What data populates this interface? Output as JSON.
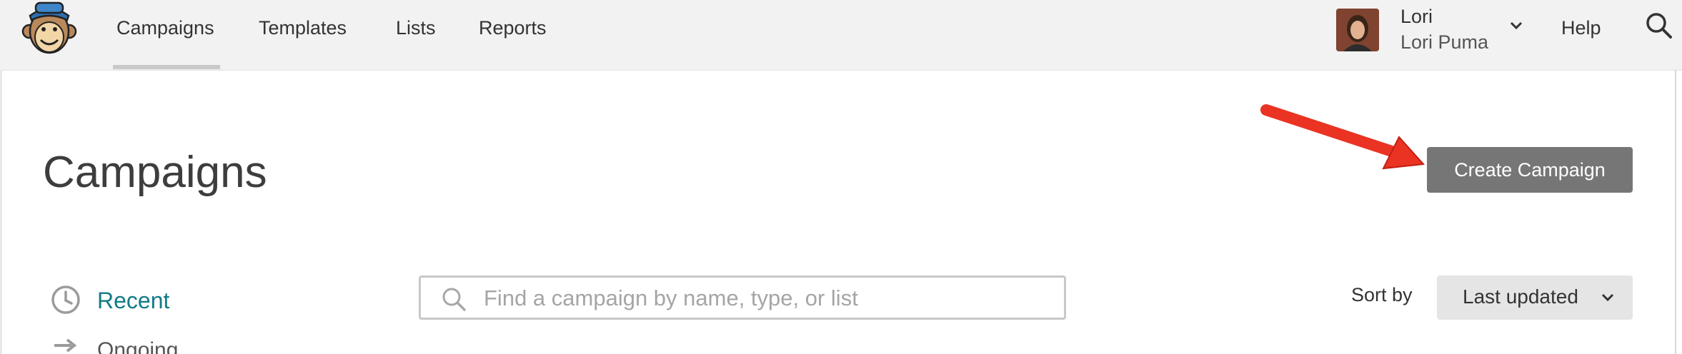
{
  "nav": {
    "items": [
      {
        "label": "Campaigns",
        "active": true
      },
      {
        "label": "Templates",
        "active": false
      },
      {
        "label": "Lists",
        "active": false
      },
      {
        "label": "Reports",
        "active": false
      }
    ],
    "user": {
      "first_name": "Lori",
      "full_name": "Lori Puma"
    },
    "help_label": "Help",
    "icons": {
      "logo": "freddie-logo-icon",
      "chevron": "chevron-down-icon",
      "search": "search-icon"
    }
  },
  "page": {
    "title": "Campaigns",
    "create_button_label": "Create Campaign",
    "annotation_color": "#ea3323"
  },
  "filters": [
    {
      "label": "Recent",
      "icon": "clock-icon",
      "active": true
    },
    {
      "label": "Ongoing",
      "icon": "arrows-icon",
      "active": false
    }
  ],
  "search": {
    "placeholder": "Find a campaign by name, type, or list",
    "value": ""
  },
  "sort": {
    "label": "Sort by",
    "selected": "Last updated"
  },
  "colors": {
    "accent": "#137b86",
    "button_bg": "#767676",
    "nav_bg": "#f2f2f2"
  }
}
